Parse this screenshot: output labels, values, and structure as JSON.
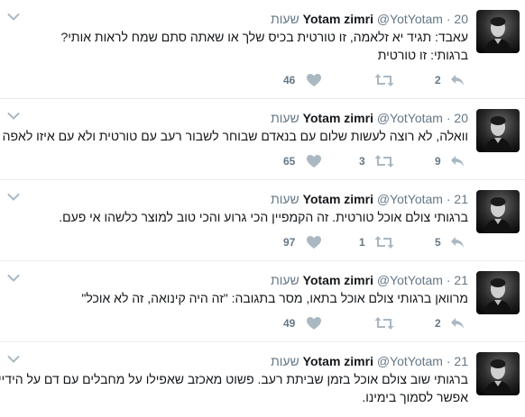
{
  "tweets": [
    {
      "name": "Yotam zimri",
      "handle": "@YotYotam",
      "time": "20 שעות",
      "lines": [
        "עאבד: תגיד יא זלאמה, זו טורטית בכיס שלך או שאתה סתם שמח לראות אותי?",
        "ברגותי: זו טורטית"
      ],
      "reply": "2",
      "retweet": "",
      "like": "46"
    },
    {
      "name": "Yotam zimri",
      "handle": "@YotYotam",
      "time": "20 שעות",
      "lines": [
        "וואלה, לא רוצה לעשות שלום עם בנאדם שבוחר לשבור רעב עם טורטית ולא עם איזו לאפה"
      ],
      "reply": "9",
      "retweet": "3",
      "like": "65"
    },
    {
      "name": "Yotam zimri",
      "handle": "@YotYotam",
      "time": "21 שעות",
      "lines": [
        "ברגותי צולם אוכל טורטית. זה הקמפיין הכי גרוע והכי טוב למוצר כלשהו אי פעם."
      ],
      "reply": "5",
      "retweet": "1",
      "like": "97"
    },
    {
      "name": "Yotam zimri",
      "handle": "@YotYotam",
      "time": "21 שעות",
      "lines": [
        "מרוואן ברגותי צולם אוכל בתאו, מסר בתגובה: \"זה היה קינואה, זה לא אוכל\""
      ],
      "reply": "2",
      "retweet": "",
      "like": "49"
    },
    {
      "name": "Yotam zimri",
      "handle": "@YotYotam",
      "time": "21 שעות",
      "lines": [
        "ברגותי שוב צולם אוכל בזמן שביתת רעב. פשוט מאכזב שאפילו על מחבלים עם דם על הידיים אי",
        "אפשר לסמוך בימינו."
      ],
      "reply": "",
      "retweet": "",
      "like": ""
    }
  ]
}
